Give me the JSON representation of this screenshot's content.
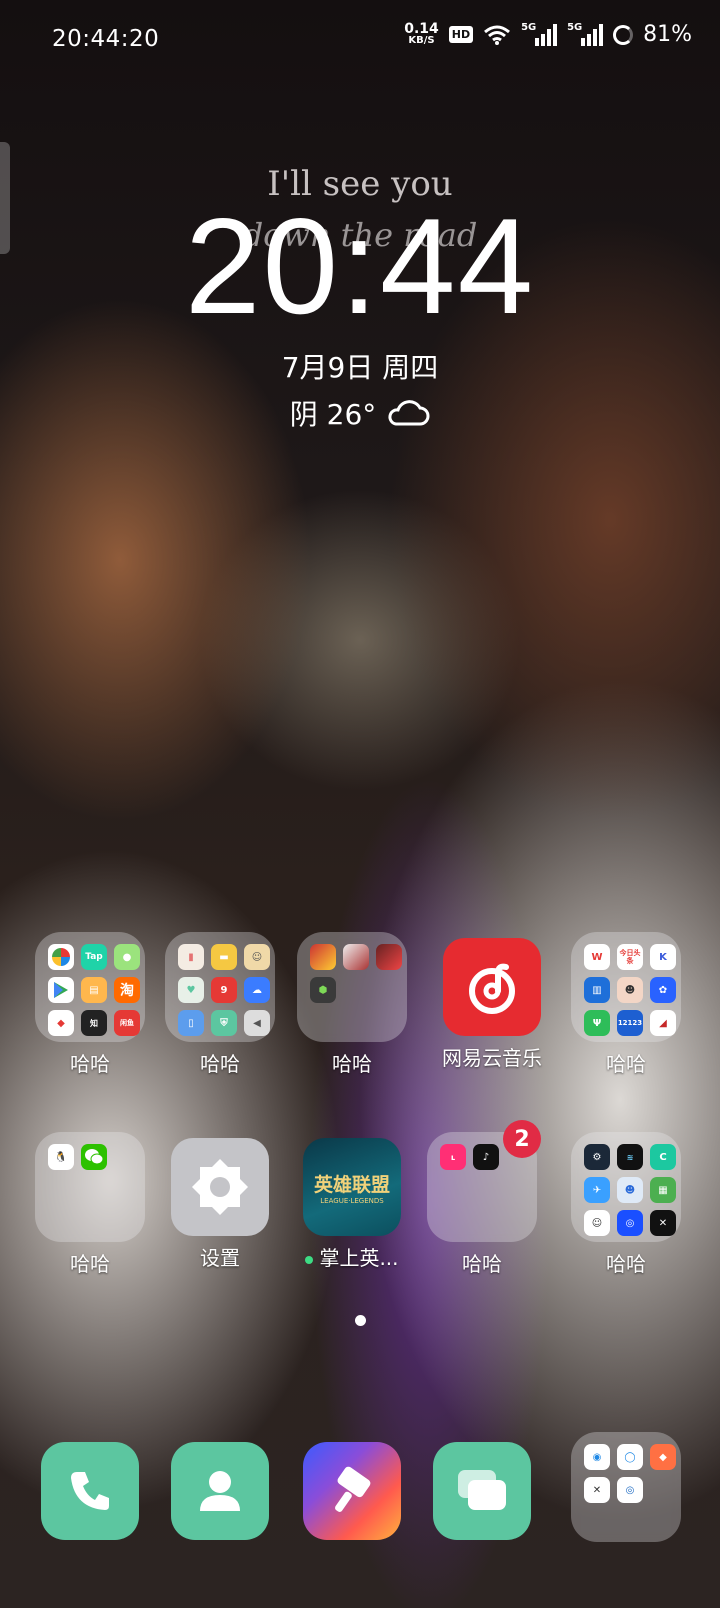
{
  "status_bar": {
    "time": "20:44:20",
    "net_speed_value": "0.14",
    "net_speed_unit": "KB/S",
    "hd_label": "HD",
    "network_1": "5G",
    "network_2": "5G",
    "battery": "81%"
  },
  "lockscreen": {
    "motto_line1": "I'll see you",
    "motto_line2": "down the road",
    "clock": "20:44",
    "date": "7月9日  周四",
    "weather": "阴 26°"
  },
  "apps_row1": [
    {
      "label": "哈哈",
      "type": "folder"
    },
    {
      "label": "哈哈",
      "type": "folder"
    },
    {
      "label": "哈哈",
      "type": "folder"
    },
    {
      "label": "网易云音乐",
      "type": "app"
    },
    {
      "label": "哈哈",
      "type": "folder"
    }
  ],
  "apps_row2": [
    {
      "label": "哈哈",
      "type": "folder"
    },
    {
      "label": "设置",
      "type": "app"
    },
    {
      "label": "掌上英...",
      "type": "app"
    },
    {
      "label": "哈哈",
      "type": "folder",
      "badge": "2"
    },
    {
      "label": "哈哈",
      "type": "folder"
    }
  ],
  "mini_icons": {
    "tap": "Tap",
    "taobao": "淘",
    "zhihu": "知",
    "xianyu": "闲鱼",
    "toutiao": "今日头条",
    "kim": "K",
    "railway": "12123",
    "lol_text": "英雄联盟",
    "lol_sub": "LEAGUE·LEGENDS"
  },
  "page_indicator": {
    "current": 1,
    "total": 1
  },
  "dock": [
    {
      "name": "phone"
    },
    {
      "name": "contacts"
    },
    {
      "name": "theme-store"
    },
    {
      "name": "messages"
    },
    {
      "name": "dock-folder"
    }
  ],
  "colors": {
    "green_tile": "#5cc6a0",
    "netease_red": "#e62b30",
    "badge_red": "#e12b45"
  }
}
